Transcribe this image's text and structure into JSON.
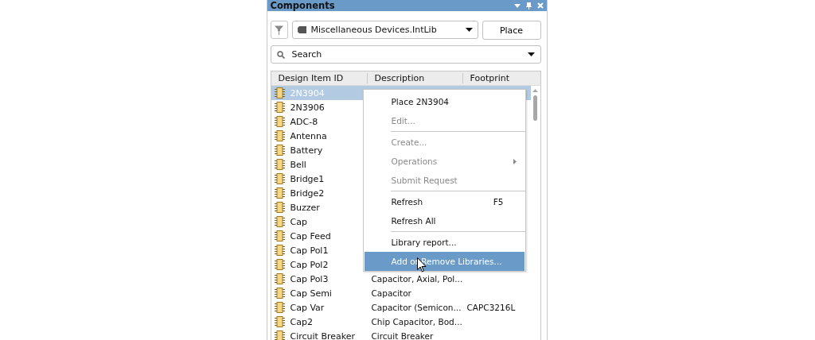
{
  "panel": {
    "title": "Components"
  },
  "library": {
    "value": "Miscellaneous Devices.IntLib"
  },
  "place_button": "Place",
  "search": {
    "placeholder": "Search"
  },
  "table": {
    "columns": [
      "Design Item ID",
      "Description",
      "Footprint"
    ],
    "rows": [
      {
        "id": "2N3904",
        "selected": true
      },
      {
        "id": "2N3906",
        "selected": false
      },
      {
        "id": "ADC-8",
        "selected": false
      },
      {
        "id": "Antenna",
        "selected": false
      },
      {
        "id": "Battery",
        "selected": false
      },
      {
        "id": "Bell",
        "selected": false
      },
      {
        "id": "Bridge1",
        "selected": false
      },
      {
        "id": "Bridge2",
        "selected": false
      },
      {
        "id": "Buzzer",
        "selected": false
      },
      {
        "id": "Cap",
        "selected": false
      },
      {
        "id": "Cap Feed",
        "selected": false
      },
      {
        "id": "Cap Pol1",
        "selected": false
      },
      {
        "id": "Cap Pol2",
        "selected": false
      },
      {
        "id": "Cap Pol3",
        "description": "Capacitor, Axial, Pol...",
        "selected": false
      },
      {
        "id": "Cap Semi",
        "description": "Capacitor",
        "selected": false
      },
      {
        "id": "Cap Var",
        "description": "Capacitor (Semicon...",
        "footprint": "CAPC3216L",
        "selected": false
      },
      {
        "id": "Cap2",
        "description": "Chip Capacitor, Bod...",
        "selected": false
      },
      {
        "id": "Circuit Breaker",
        "description": "Circuit Breaker",
        "selected": false
      }
    ]
  },
  "context_menu": [
    {
      "kind": "item",
      "label": "Place 2N3904",
      "disabled": false,
      "selected": false
    },
    {
      "kind": "item",
      "label": "Edit...",
      "disabled": true,
      "selected": false
    },
    {
      "kind": "separator"
    },
    {
      "kind": "item",
      "label": "Create...",
      "disabled": true,
      "selected": false
    },
    {
      "kind": "submenu",
      "label": "Operations",
      "disabled": true,
      "selected": false
    },
    {
      "kind": "item",
      "label": "Submit Request",
      "disabled": true,
      "selected": false
    },
    {
      "kind": "separator"
    },
    {
      "kind": "item",
      "label": "Refresh",
      "shortcut": "F5",
      "disabled": false,
      "selected": false
    },
    {
      "kind": "item",
      "label": "Refresh All",
      "disabled": false,
      "selected": false
    },
    {
      "kind": "separator"
    },
    {
      "kind": "item",
      "label": "Library report...",
      "disabled": false,
      "selected": false
    },
    {
      "kind": "item",
      "label": "Add or Remove Libraries...",
      "disabled": false,
      "selected": true
    }
  ]
}
